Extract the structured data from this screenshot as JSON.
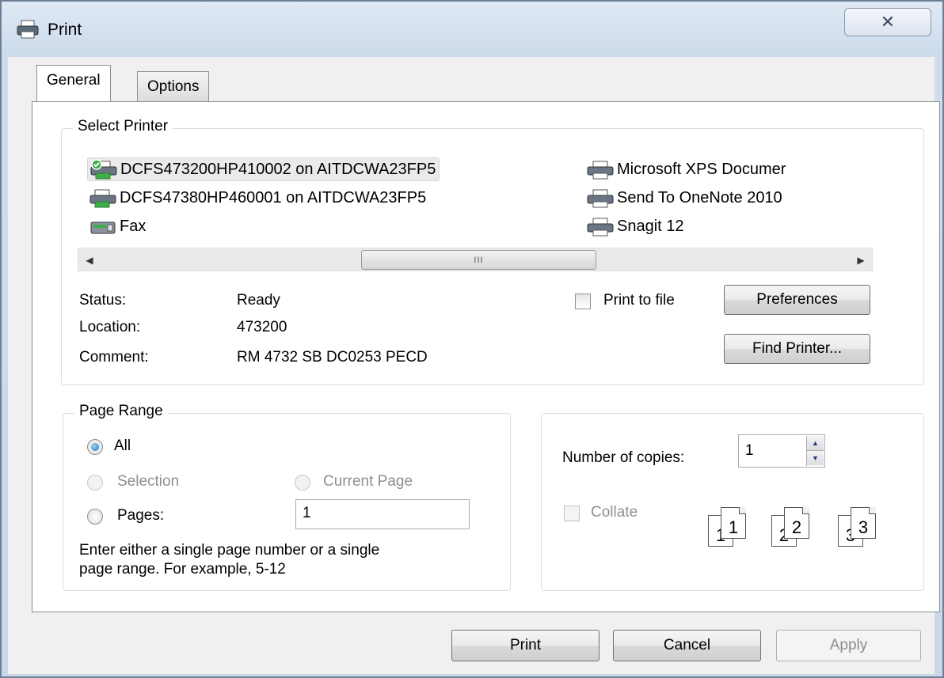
{
  "window": {
    "title": "Print",
    "close_glyph": "✕"
  },
  "tabs": [
    {
      "label": "General"
    },
    {
      "label": "Options"
    }
  ],
  "select_printer": {
    "legend": "Select Printer",
    "printers_left": [
      {
        "name": "DCFS473200HP410002 on AITDCWA23FP5",
        "icon": "default-printer-icon"
      },
      {
        "name": "DCFS47380HP460001 on AITDCWA23FP5",
        "icon": "network-printer-icon"
      },
      {
        "name": "Fax",
        "icon": "fax-icon"
      }
    ],
    "printers_right": [
      {
        "name": "Microsoft XPS Documer",
        "icon": "printer-icon"
      },
      {
        "name": "Send To OneNote 2010",
        "icon": "printer-icon"
      },
      {
        "name": "Snagit 12",
        "icon": "printer-icon"
      }
    ],
    "scroll_thumb_grip": "III",
    "status_label": "Status:",
    "status_value": "Ready",
    "location_label": "Location:",
    "location_value": "473200",
    "comment_label": "Comment:",
    "comment_value": "RM 4732 SB DC0253  PECD",
    "print_to_file_label": "Print to file",
    "print_to_file_checked": false,
    "preferences_label": "Preferences",
    "find_printer_label": "Find Printer..."
  },
  "page_range": {
    "legend": "Page Range",
    "all_label": "All",
    "selection_label": "Selection",
    "current_page_label": "Current Page",
    "pages_label": "Pages:",
    "pages_value": "1",
    "selected": "All",
    "help_line1": "Enter either a single page number or a single",
    "help_line2": "page range.  For example, 5-12"
  },
  "copies": {
    "label": "Number of copies:",
    "value": "1",
    "collate_label": "Collate",
    "collate_checked": false,
    "collate_pages": [
      "1",
      "2",
      "3"
    ]
  },
  "buttons": {
    "print": "Print",
    "cancel": "Cancel",
    "apply": "Apply"
  },
  "colors": {
    "accent_radio": "#1a6fb6",
    "frame": "#c9d7e8"
  }
}
